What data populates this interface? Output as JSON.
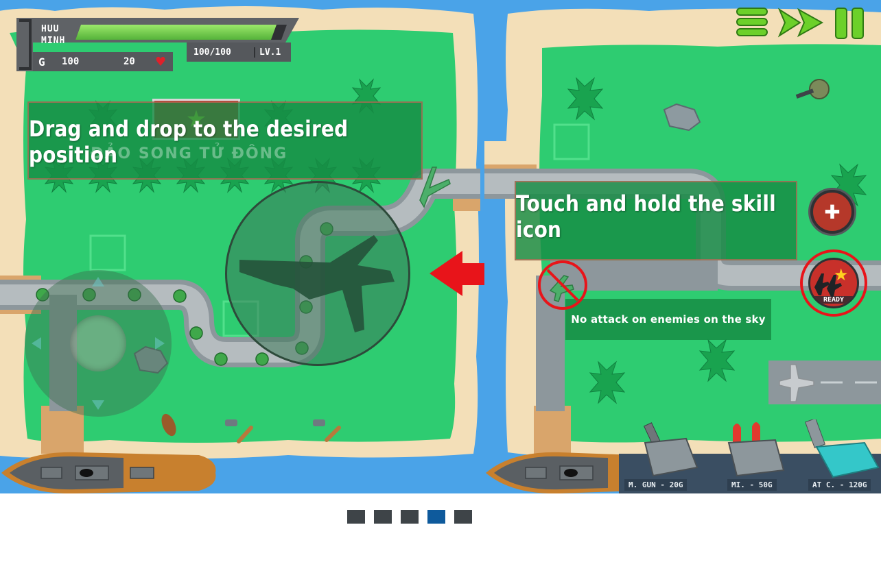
{
  "hud": {
    "player_name_line1": "HUU",
    "player_name_line2": "MINH",
    "health_fraction": 0.95,
    "health_text": "100/100",
    "level_text": "LV.1",
    "gold_label": "G",
    "gold_value": "100",
    "lives_value": "20",
    "heart_icon": "heart-icon"
  },
  "controls": {
    "menu_icon": "hamburger-menu-icon",
    "fast_forward_icon": "fast-forward-icon",
    "pause_icon": "pause-icon"
  },
  "tutorial": {
    "drag_hint": "Drag and drop to the desired position",
    "island_name": "ĐẢO SONG TỬ ĐÔNG",
    "skill_hint": "Touch and hold the skill icon",
    "no_air_attack_hint": "No attack on enemies on the sky"
  },
  "skills": {
    "heal_icon": "heal-skill-icon",
    "airstrike_icon": "airstrike-skill-icon",
    "airstrike_status": "READY"
  },
  "towers": [
    {
      "label": "M. GUN - 20G"
    },
    {
      "label": "MI. - 50G"
    },
    {
      "label": "AT C. - 120G"
    }
  ],
  "pagination": {
    "count": 5,
    "active_index": 3
  },
  "colors": {
    "sea": "#4aa3e8",
    "grass": "#2ecc71",
    "sand": "#f3dfb8",
    "banner": "#168c44",
    "arrow_red": "#e8141a",
    "dot_inactive": "#3e4448",
    "dot_active": "#0e5a9c"
  }
}
